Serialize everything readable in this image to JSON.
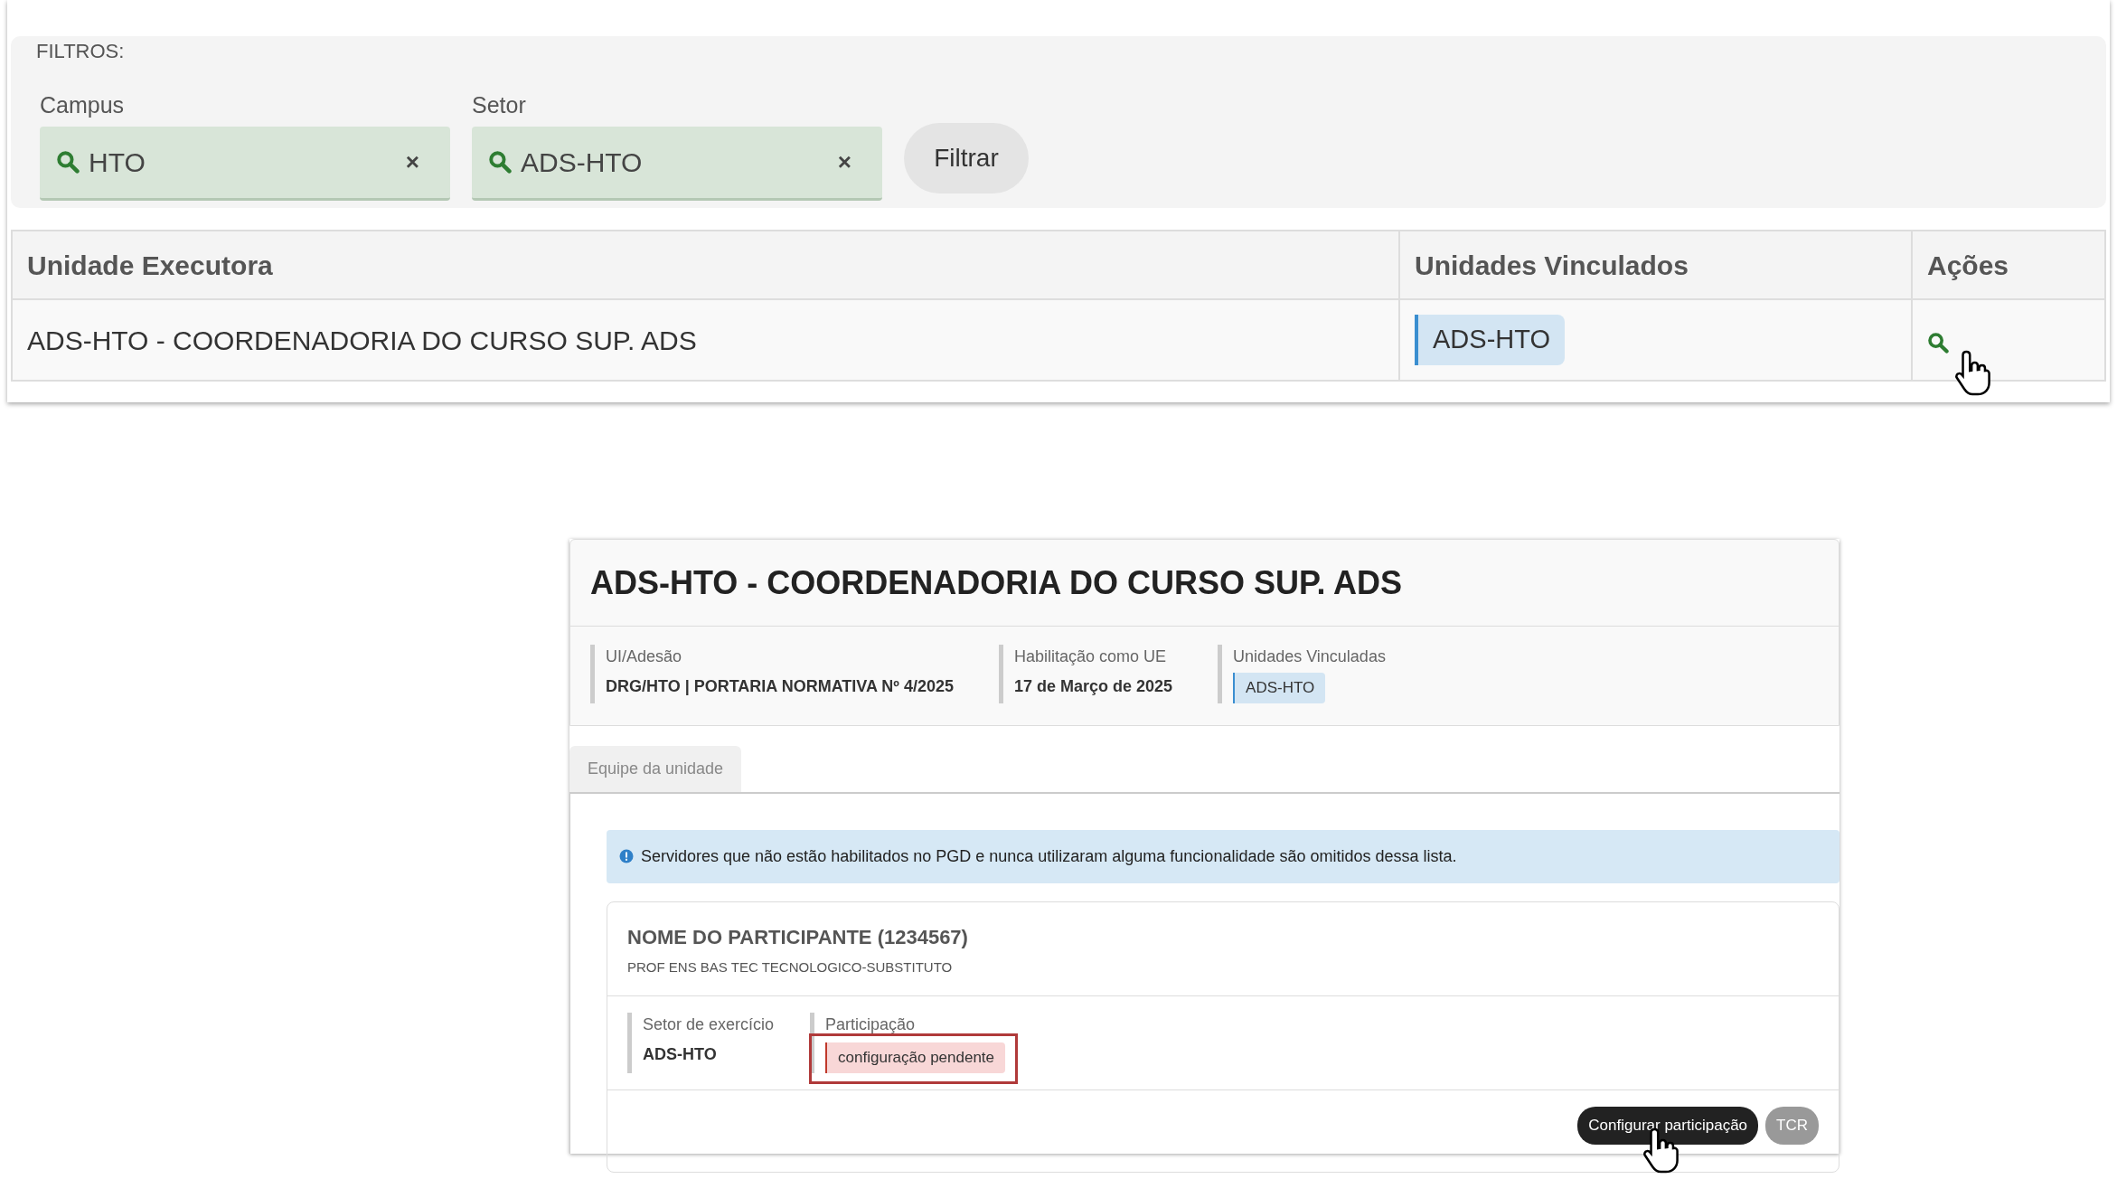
{
  "filters": {
    "title": "FILTROS:",
    "fields": [
      {
        "label": "Campus",
        "value": "HTO",
        "clear": "×"
      },
      {
        "label": "Setor",
        "value": "ADS-HTO",
        "clear": "×"
      }
    ],
    "button": "Filtrar"
  },
  "table": {
    "columns": [
      "Unidade Executora",
      "Unidades Vinculados",
      "Ações"
    ],
    "rows": [
      {
        "unidade": "ADS-HTO - COORDENADORIA DO CURSO SUP. ADS",
        "vinculados": [
          "ADS-HTO"
        ]
      }
    ]
  },
  "detail": {
    "title": "ADS-HTO - COORDENADORIA DO CURSO SUP. ADS",
    "info": [
      {
        "kind": "text",
        "label": "UI/Adesão",
        "value": "DRG/HTO | PORTARIA NORMATIVA Nº 4/2025"
      },
      {
        "kind": "text",
        "label": "Habilitação como UE",
        "value": "17 de Março de 2025"
      },
      {
        "kind": "tags",
        "label": "Unidades Vinculadas",
        "tags": [
          "ADS-HTO"
        ]
      }
    ],
    "tabs": [
      {
        "label": "Equipe da unidade",
        "selected": true
      }
    ],
    "alert": "Servidores que não estão habilitados no PGD e nunca utilizaram alguma funcionalidade são omitidos dessa lista.",
    "participants": [
      {
        "name": "NOME DO PARTICIPANTE (1234567)",
        "role": "PROF ENS BAS TEC TECNOLOGICO-SUBSTITUTO",
        "fields": [
          {
            "kind": "text",
            "label": "Setor de exercício",
            "value": "ADS-HTO"
          },
          {
            "kind": "status",
            "label": "Participação",
            "value": "configuração pendente"
          }
        ],
        "actions": [
          {
            "kind": "primary",
            "label": "Configurar participação"
          },
          {
            "kind": "secondary",
            "label": "TCR"
          }
        ]
      }
    ]
  }
}
